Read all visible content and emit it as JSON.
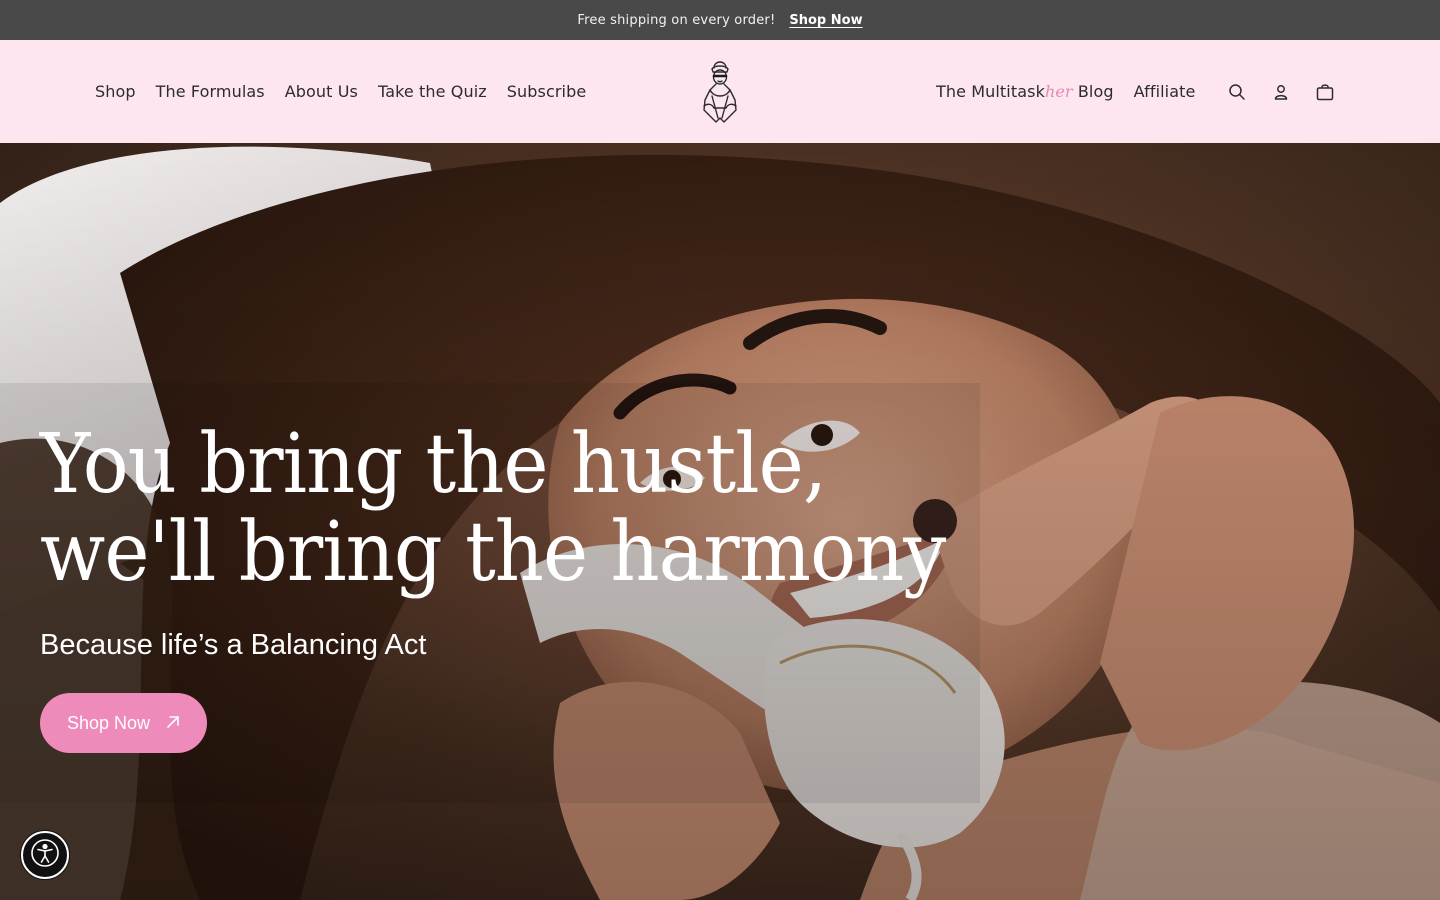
{
  "announcement": {
    "message": "Free shipping on every order!",
    "link_label": "Shop Now"
  },
  "nav_left": [
    {
      "label": "Shop"
    },
    {
      "label": "The Formulas"
    },
    {
      "label": "About Us"
    },
    {
      "label": "Take the Quiz"
    },
    {
      "label": "Subscribe"
    }
  ],
  "nav_right": {
    "blog_prefix": "The Multitask",
    "blog_accent": "her",
    "blog_suffix": " Blog",
    "affiliate": "Affiliate"
  },
  "header_icons": [
    "search-icon",
    "account-icon",
    "cart-icon"
  ],
  "hero": {
    "title_line1": "You bring the hustle,",
    "title_line2": "we'll bring the harmony",
    "subtitle": "Because life’s a Balancing Act",
    "cta_label": "Shop Now",
    "cta_icon": "arrow-up-right-icon"
  },
  "accessibility_icon": "accessibility-icon",
  "colors": {
    "announcement_bg": "#494949",
    "header_bg": "#fde6f0",
    "accent_pink": "#ee8bbb",
    "text_dark": "#2c2c2c"
  }
}
